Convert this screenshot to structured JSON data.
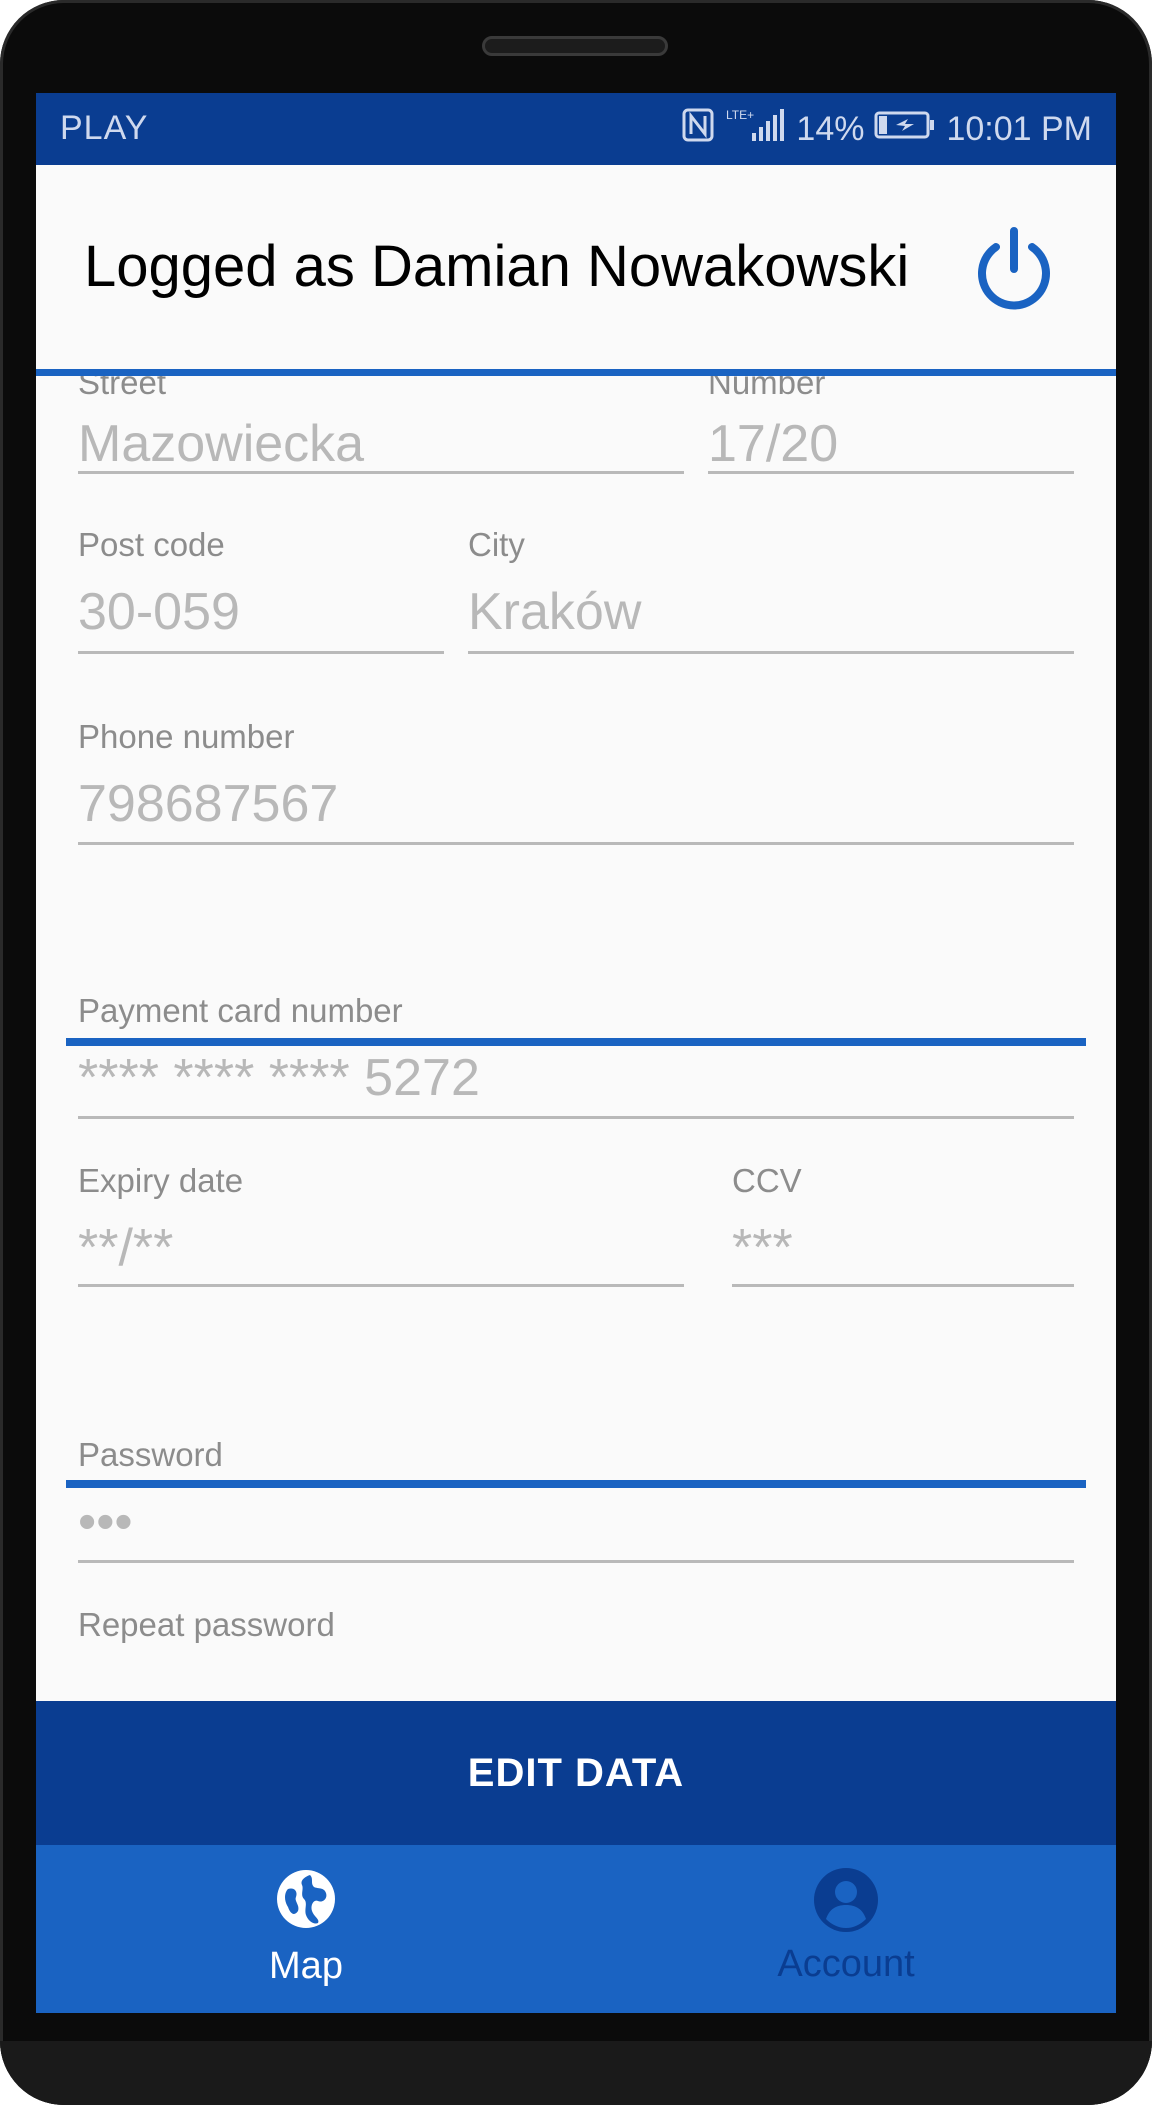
{
  "status_bar": {
    "carrier": "PLAY",
    "network": "LTE+",
    "battery": "14%",
    "time": "10:01 PM"
  },
  "header": {
    "title": "Logged as Damian Nowakowski",
    "power_icon": "power-icon"
  },
  "address": {
    "street": {
      "label": "Street",
      "value": "Mazowiecka"
    },
    "number": {
      "label": "Number",
      "value": "17/20"
    },
    "post_code": {
      "label": "Post code",
      "value": "30-059"
    },
    "city": {
      "label": "City",
      "value": "Kraków"
    },
    "phone": {
      "label": "Phone number",
      "value": "798687567"
    }
  },
  "payment": {
    "card_number": {
      "label": "Payment card number",
      "value": "**** **** **** 5272"
    },
    "expiry": {
      "label": "Expiry date",
      "value": "**/**"
    },
    "ccv": {
      "label": "CCV",
      "value": "***"
    }
  },
  "security": {
    "password": {
      "label": "Password",
      "value": "•••"
    },
    "repeat_password": {
      "label": "Repeat password"
    }
  },
  "edit_button": {
    "label": "EDIT DATA"
  },
  "bottom_nav": {
    "items": [
      {
        "label": "Map",
        "icon": "globe-icon",
        "active": true
      },
      {
        "label": "Account",
        "icon": "account-icon",
        "active": false
      }
    ]
  },
  "colors": {
    "primary_dark": "#0a3d91",
    "primary": "#1a63c2",
    "hint_text": "#b8b8b8",
    "label_text": "#8c8c8c"
  }
}
